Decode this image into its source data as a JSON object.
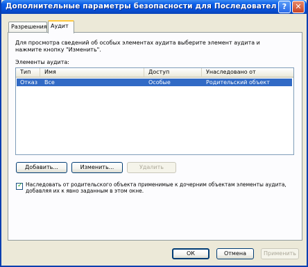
{
  "window": {
    "title": "Дополнительные параметры безопасности для Последовательный порт [... ",
    "help_glyph": "?",
    "close_glyph": "✕"
  },
  "tabs": [
    {
      "label": "Разрешения"
    },
    {
      "label": "Аудит"
    }
  ],
  "audit": {
    "description": "Для просмотра сведений об особых элементах аудита выберите элемент аудита и нажмите кнопку \"Изменить\".",
    "list_label": "Элементы аудита:",
    "columns": [
      "Тип",
      "Имя",
      "Доступ",
      "Унаследовано от"
    ],
    "rows": [
      {
        "type": "Отказ",
        "name": "Все",
        "access": "Особые",
        "inherited": "Родительский объект",
        "selected": true
      }
    ],
    "buttons": {
      "add": "Добавить...",
      "edit": "Изменить...",
      "remove": "Удалить"
    },
    "inherit_checkbox": {
      "checked": true,
      "label": "Наследовать от родительского объекта применимые к дочерним объектам элементы аудита, добавляя их к явно заданным в этом окне."
    }
  },
  "footer": {
    "ok": "ОК",
    "cancel": "Отмена",
    "apply": "Применить"
  }
}
